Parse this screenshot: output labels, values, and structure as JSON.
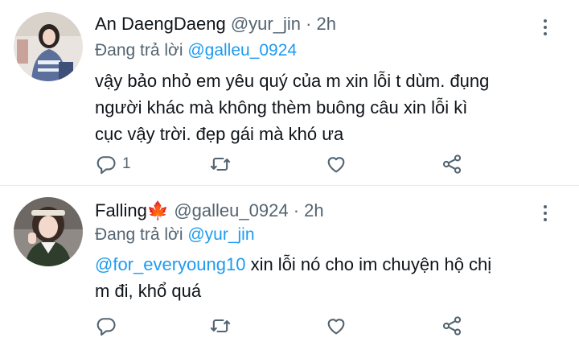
{
  "tweets": [
    {
      "name": "An DaengDaeng",
      "name_suffix": "",
      "handle": "@yur_jin",
      "time": "2h",
      "reply_prefix": "Đang trả lời",
      "reply_to": "@galleu_0924",
      "body_lines": [
        "vậy bảo nhỏ em yêu quý của m xin lỗi t dùm. đụng",
        "người khác mà không thèm buông câu xin lỗi kì",
        "cục vậy trời. đẹp gái mà khó ưa"
      ],
      "reply_count": "1"
    },
    {
      "name": "Falling",
      "name_suffix": "🍁",
      "handle": "@galleu_0924",
      "time": "2h",
      "reply_prefix": "Đang trả lời",
      "reply_to": "@yur_jin",
      "body_mention": "@for_everyoung10",
      "body_lines": [
        " xin lỗi nó cho im chuyện hộ chị",
        "m đi, khổ quá"
      ],
      "reply_count": ""
    }
  ],
  "separator": "·",
  "icons": [
    "reply-icon",
    "retweet-icon",
    "like-icon",
    "share-icon",
    "more-icon"
  ],
  "colors": {
    "accent": "#1d9bf0",
    "secondary": "#536471",
    "text": "#0f1419"
  }
}
